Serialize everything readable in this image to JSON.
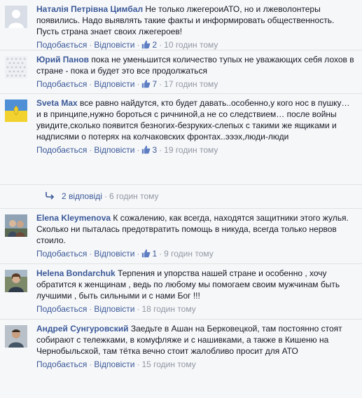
{
  "colors": {
    "background": "#f6f7f9",
    "link": "#3b5998",
    "muted": "#9197a3",
    "divider": "#e1e2e3"
  },
  "actions": {
    "like_label": "Подобається",
    "reply_label": "Відповісти",
    "separator": "·",
    "like_icon": "thumbs-up-icon"
  },
  "comments": [
    {
      "author": "Наталія Петрівна Цимбал",
      "text": "Не только лжегероиАТО, но и лжеволонтеры появились. Надо выявлять такие факты и информировать общественность. Пусть страна знает своих лжегероев!",
      "likes": "2",
      "time": "10 годин тому",
      "avatar_icon": "default-avatar-icon"
    },
    {
      "author": "Юрий Панов",
      "text": "пока не уменьшится количество тупых не уважающих себя лохов в стране - пока и будет это все продолжаться",
      "likes": "7",
      "time": "17 годин тому",
      "avatar_icon": "dotted-pattern-avatar-icon"
    },
    {
      "author": "Sveta Max",
      "text": "все равно найдутся, кто будет давать..особенно,у кого нос в пушку… и в принципе,нужно бороться с ричниной,а не со следствием… после войны увидите,сколько появится безногих-безруких-слепых с такими же ящиками и надписями о потерях на колчаковских фронтах..эээх,люди-люди",
      "likes": "3",
      "time": "19 годин тому",
      "avatar_icon": "flag-avatar-icon"
    },
    {
      "author": "Elena Kleymenova",
      "text": "К сожалению, как всегда, находятся защитники этого жулья. Сколько ни пыталась предотвратить помощь в никуда, всегда только нервов стоило.",
      "likes": "1",
      "time": "9 годин тому",
      "avatar_icon": "photo-avatar-icon"
    },
    {
      "author": "Helena Bondarchuk",
      "text": "Терпения и упорства нашей стране и особенно , хочу обратится к женщинам , ведь по любому мы помогаем своим мужчинам быть лучшими , быть сильными и с нами Бог !!!",
      "likes": "",
      "time": "18 годин тому",
      "avatar_icon": "photo-avatar-icon"
    },
    {
      "author": "Андрей Сунгуровский",
      "text": "Заедьте в Ашан на Берковецкой, там постоянно стоят собирают с тележками, в комуфляже и с нашивками, а также в Кишеню на Чернобыльской, там тётка вечно стоит жалобливо просит для АТО",
      "likes": "",
      "time": "15 годин тому",
      "avatar_icon": "photo-avatar-icon"
    }
  ],
  "replies_summary": {
    "label": "2 відповіді",
    "time": "6 годин тому",
    "icon": "reply-arrow-icon"
  }
}
